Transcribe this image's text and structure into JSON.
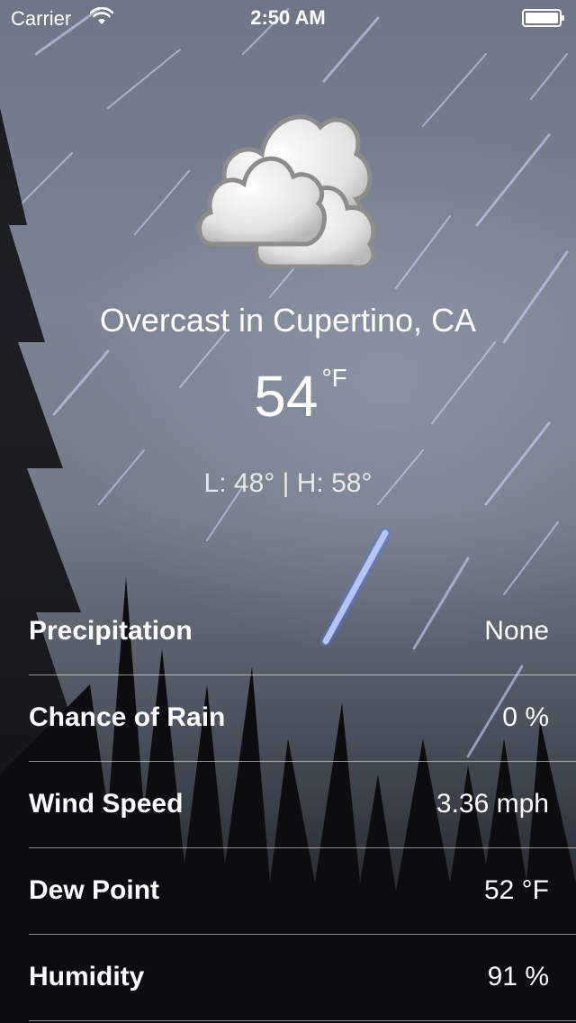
{
  "status_bar": {
    "carrier": "Carrier",
    "time": "2:50 AM",
    "icons": [
      "wifi-icon",
      "battery-icon"
    ]
  },
  "weather": {
    "icon": "overcast-clouds-icon",
    "title": "Overcast in Cupertino, CA",
    "temperature": "54",
    "unit": "°F",
    "low_high": "L: 48° | H: 58°"
  },
  "details": [
    {
      "label": "Precipitation",
      "value": "None"
    },
    {
      "label": "Chance of Rain",
      "value": "0 %"
    },
    {
      "label": "Wind Speed",
      "value": "3.36 mph"
    },
    {
      "label": "Dew Point",
      "value": "52 °F"
    },
    {
      "label": "Humidity",
      "value": "91 %"
    }
  ],
  "colors": {
    "text": "#ffffff",
    "separator": "#ffffff"
  }
}
